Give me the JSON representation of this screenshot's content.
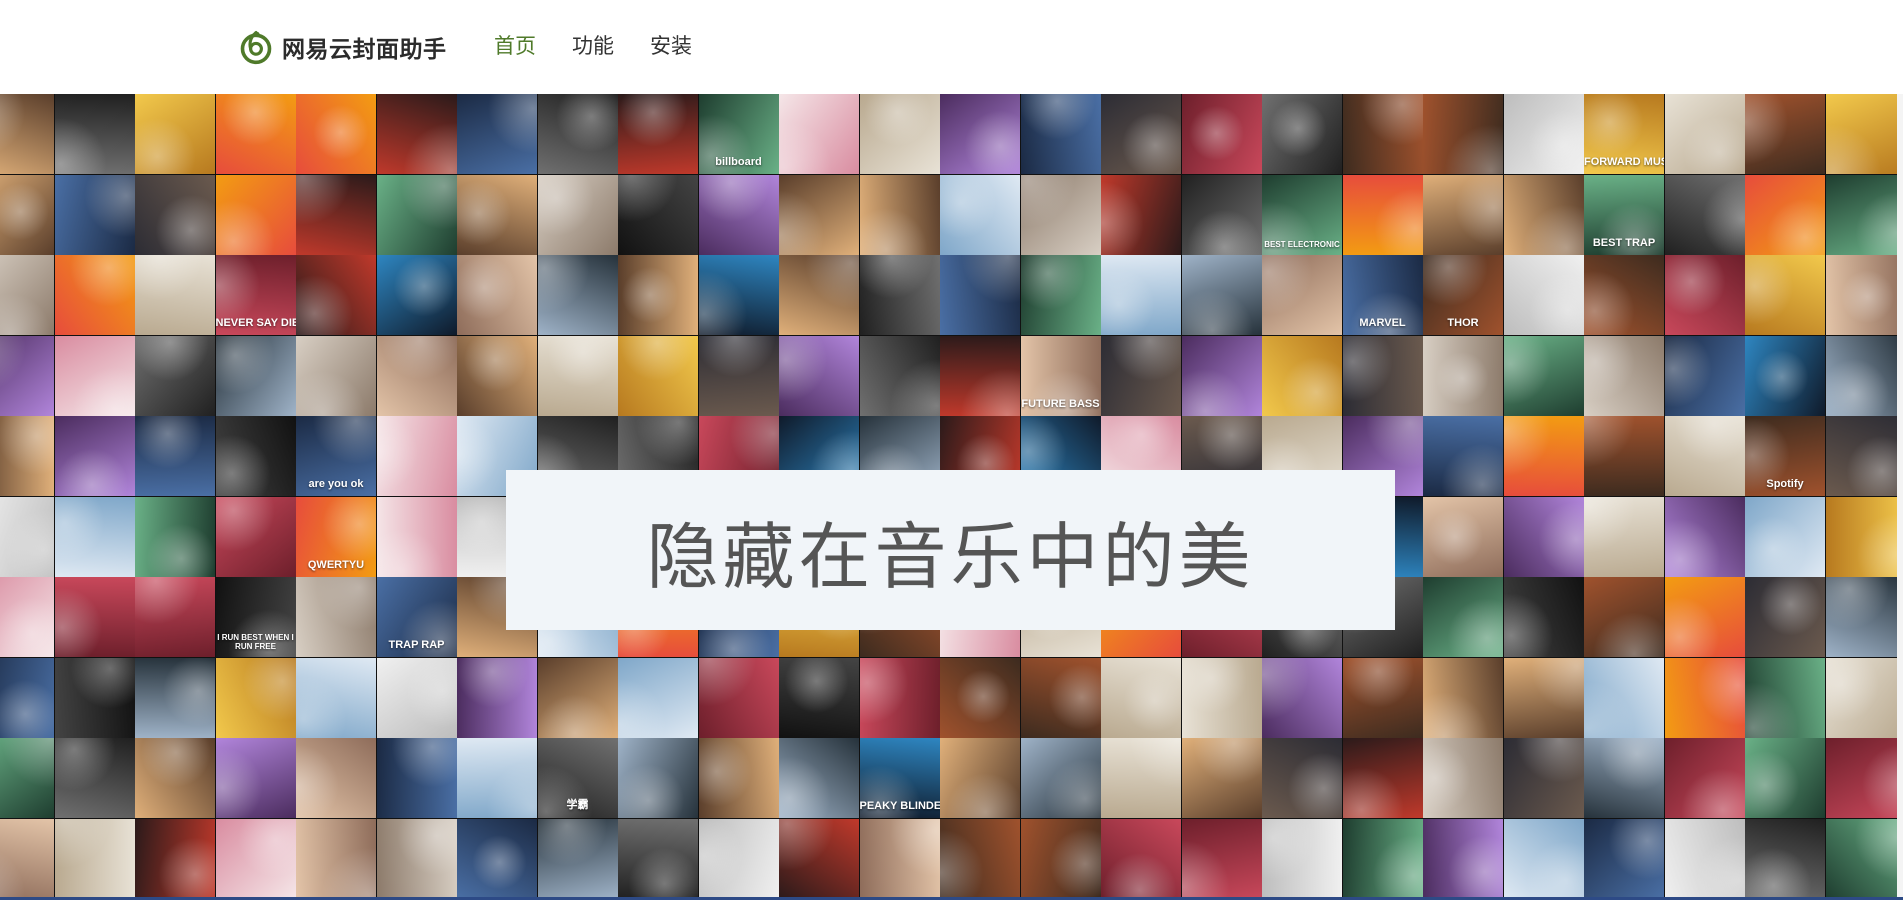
{
  "header": {
    "brand_name": "网易云封面助手",
    "nav": [
      {
        "label": "首页",
        "active": true
      },
      {
        "label": "功能",
        "active": false
      },
      {
        "label": "安装",
        "active": false
      }
    ]
  },
  "hero": {
    "title": "隐藏在音乐中的美"
  },
  "icons": {
    "logo": "netease-music-logo-icon"
  },
  "colors": {
    "accent": "#4f7a2a",
    "hero_bg": "#f1f5f9"
  },
  "tile_labels": [
    "billboard",
    "FORWARD MUSIC",
    "NEVER SAY DIE",
    "BEST ELECTRONIC",
    "BEST TRAP",
    "MARVEL",
    "THOR",
    "FUTURE BASS",
    "Spotify",
    "I RUN BEST WHEN I RUN FREE",
    "TRAP RAP",
    "PEAKY BLINDERS",
    "学霸",
    "are you ok",
    "QWERTYU"
  ]
}
